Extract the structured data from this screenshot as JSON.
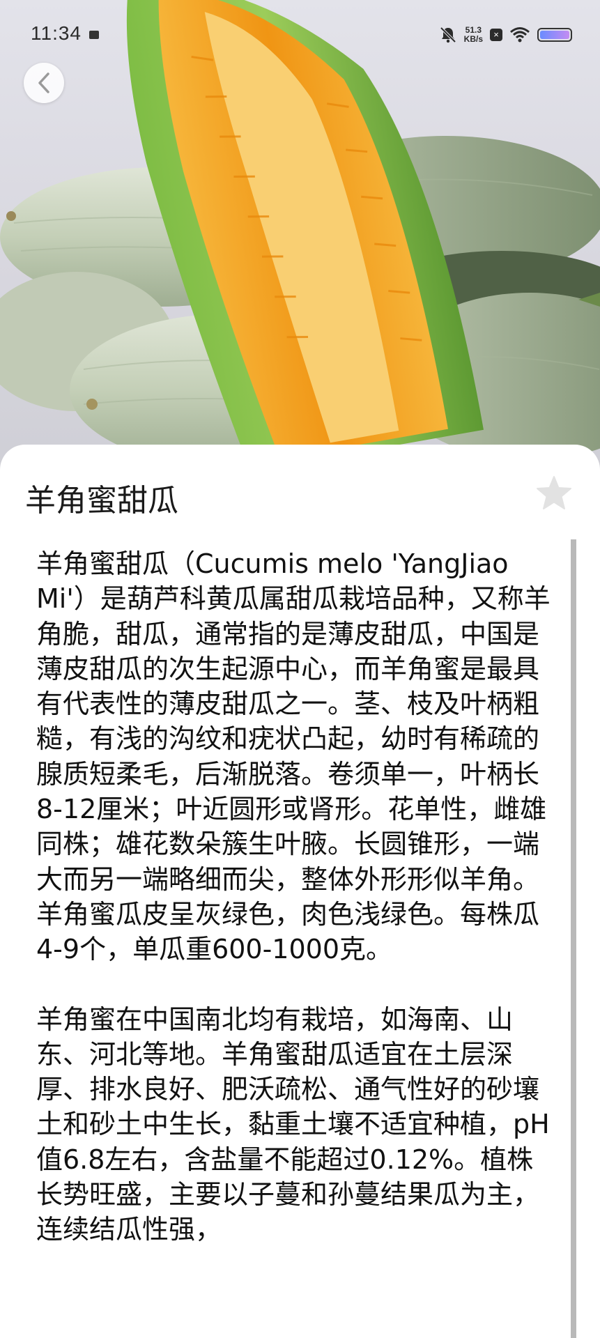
{
  "status_bar": {
    "time": "11:34",
    "net_speed_value": "51.3",
    "net_speed_unit": "KB/s",
    "icons": [
      "sim-icon",
      "bell-muted-icon",
      "close-box-icon",
      "wifi-icon",
      "battery-icon"
    ]
  },
  "hero": {
    "icon": "melon-photo"
  },
  "back": {
    "icon": "chevron-left-icon"
  },
  "detail": {
    "title": "羊角蜜甜瓜",
    "favorite_icon": "star-icon",
    "paragraphs": [
      "羊角蜜甜瓜（Cucumis melo 'YangJiao Mi'）是葫芦科黄瓜属甜瓜栽培品种，又称羊角脆，甜瓜，通常指的是薄皮甜瓜，中国是薄皮甜瓜的次生起源中心，而羊角蜜是最具有代表性的薄皮甜瓜之一。茎、枝及叶柄粗糙，有浅的沟纹和疣状凸起，幼时有稀疏的腺质短柔毛，后渐脱落。卷须单一，叶柄长8-12厘米；叶近圆形或肾形。花单性，雌雄同株；雄花数朵簇生叶腋。长圆锥形，一端大而另一端略细而尖，整体外形形似羊角。羊角蜜瓜皮呈灰绿色，肉色浅绿色。每株瓜4-9个，单瓜重600-1000克。",
      "羊角蜜在中国南北均有栽培，如海南、山东、河北等地。羊角蜜甜瓜适宜在土层深厚、排水良好、肥沃疏松、通气性好的砂壤土和砂土中生长，黏重土壤不适宜种植，pH值6.8左右，含盐量不能超过0.12%。植株长势旺盛，主要以子蔓和孙蔓结果瓜为主，连续结瓜性强，"
    ]
  },
  "colors": {
    "sheet_bg": "#ffffff",
    "star": "#e2e2e2",
    "scrollbar": "#b9b9b9",
    "melon_rind": "#c9d3bf",
    "melon_flesh": "#f0a21f"
  }
}
